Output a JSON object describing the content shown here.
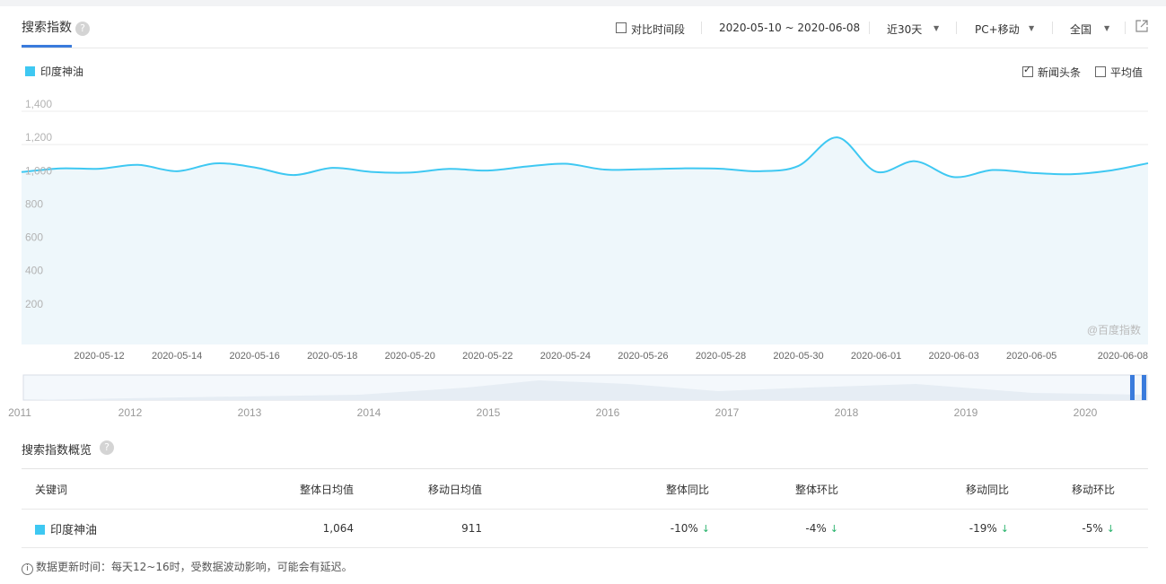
{
  "header": {
    "tab_title": "搜索指数",
    "help_glyph": "?",
    "compare_label": "对比时间段",
    "date_range": "2020-05-10 ~ 2020-06-08",
    "period": "近30天",
    "device": "PC+移动",
    "region": "全国"
  },
  "legend": {
    "series_label": "印度神油",
    "news_label": "新闻头条",
    "avg_label": "平均值",
    "news_checked": true,
    "avg_checked": false
  },
  "watermark": "@百度指数",
  "colors": {
    "line": "#3ec8f2",
    "fill": "#eef7fb",
    "accent": "#3a7bdc",
    "down": "#27b26b"
  },
  "chart_data": {
    "type": "area",
    "ylim": [
      0,
      1400
    ],
    "yticks": [
      "1,400",
      "1,200",
      "1,000",
      "800",
      "600",
      "400",
      "200"
    ],
    "ytick_values": [
      1400,
      1200,
      1000,
      800,
      600,
      400,
      200
    ],
    "xtick_labels": [
      "2020-05-12",
      "2020-05-14",
      "2020-05-16",
      "2020-05-18",
      "2020-05-20",
      "2020-05-22",
      "2020-05-24",
      "2020-05-26",
      "2020-05-28",
      "2020-05-30",
      "2020-06-01",
      "2020-06-03",
      "2020-06-05",
      "2020-06-08"
    ],
    "x": [
      "2020-05-10",
      "2020-05-11",
      "2020-05-12",
      "2020-05-13",
      "2020-05-14",
      "2020-05-15",
      "2020-05-16",
      "2020-05-17",
      "2020-05-18",
      "2020-05-19",
      "2020-05-20",
      "2020-05-21",
      "2020-05-22",
      "2020-05-23",
      "2020-05-24",
      "2020-05-25",
      "2020-05-26",
      "2020-05-27",
      "2020-05-28",
      "2020-05-29",
      "2020-05-30",
      "2020-05-31",
      "2020-06-01",
      "2020-06-02",
      "2020-06-03",
      "2020-06-04",
      "2020-06-05",
      "2020-06-06",
      "2020-06-07",
      "2020-06-08"
    ],
    "series": [
      {
        "name": "印度神油",
        "values": [
          1035,
          1057,
          1055,
          1078,
          1040,
          1087,
          1063,
          1017,
          1060,
          1036,
          1032,
          1054,
          1044,
          1068,
          1085,
          1050,
          1052,
          1057,
          1055,
          1040,
          1072,
          1243,
          1037,
          1100,
          1005,
          1047,
          1030,
          1022,
          1043,
          1088
        ]
      }
    ]
  },
  "navigator": {
    "years": [
      "2011",
      "2012",
      "2013",
      "2014",
      "2015",
      "2016",
      "2017",
      "2018",
      "2019",
      "2020"
    ]
  },
  "overview": {
    "title": "搜索指数概览",
    "columns": [
      "关键词",
      "整体日均值",
      "移动日均值",
      "整体同比",
      "整体环比",
      "移动同比",
      "移动环比"
    ],
    "row": {
      "keyword": "印度神油",
      "overall_avg": "1,064",
      "mobile_avg": "911",
      "overall_yoy": "-10%",
      "overall_mom": "-4%",
      "mobile_yoy": "-19%",
      "mobile_mom": "-5%",
      "arrow": "↓"
    }
  },
  "note": "数据更新时间：每天12~16时，受数据波动影响，可能会有延迟。"
}
